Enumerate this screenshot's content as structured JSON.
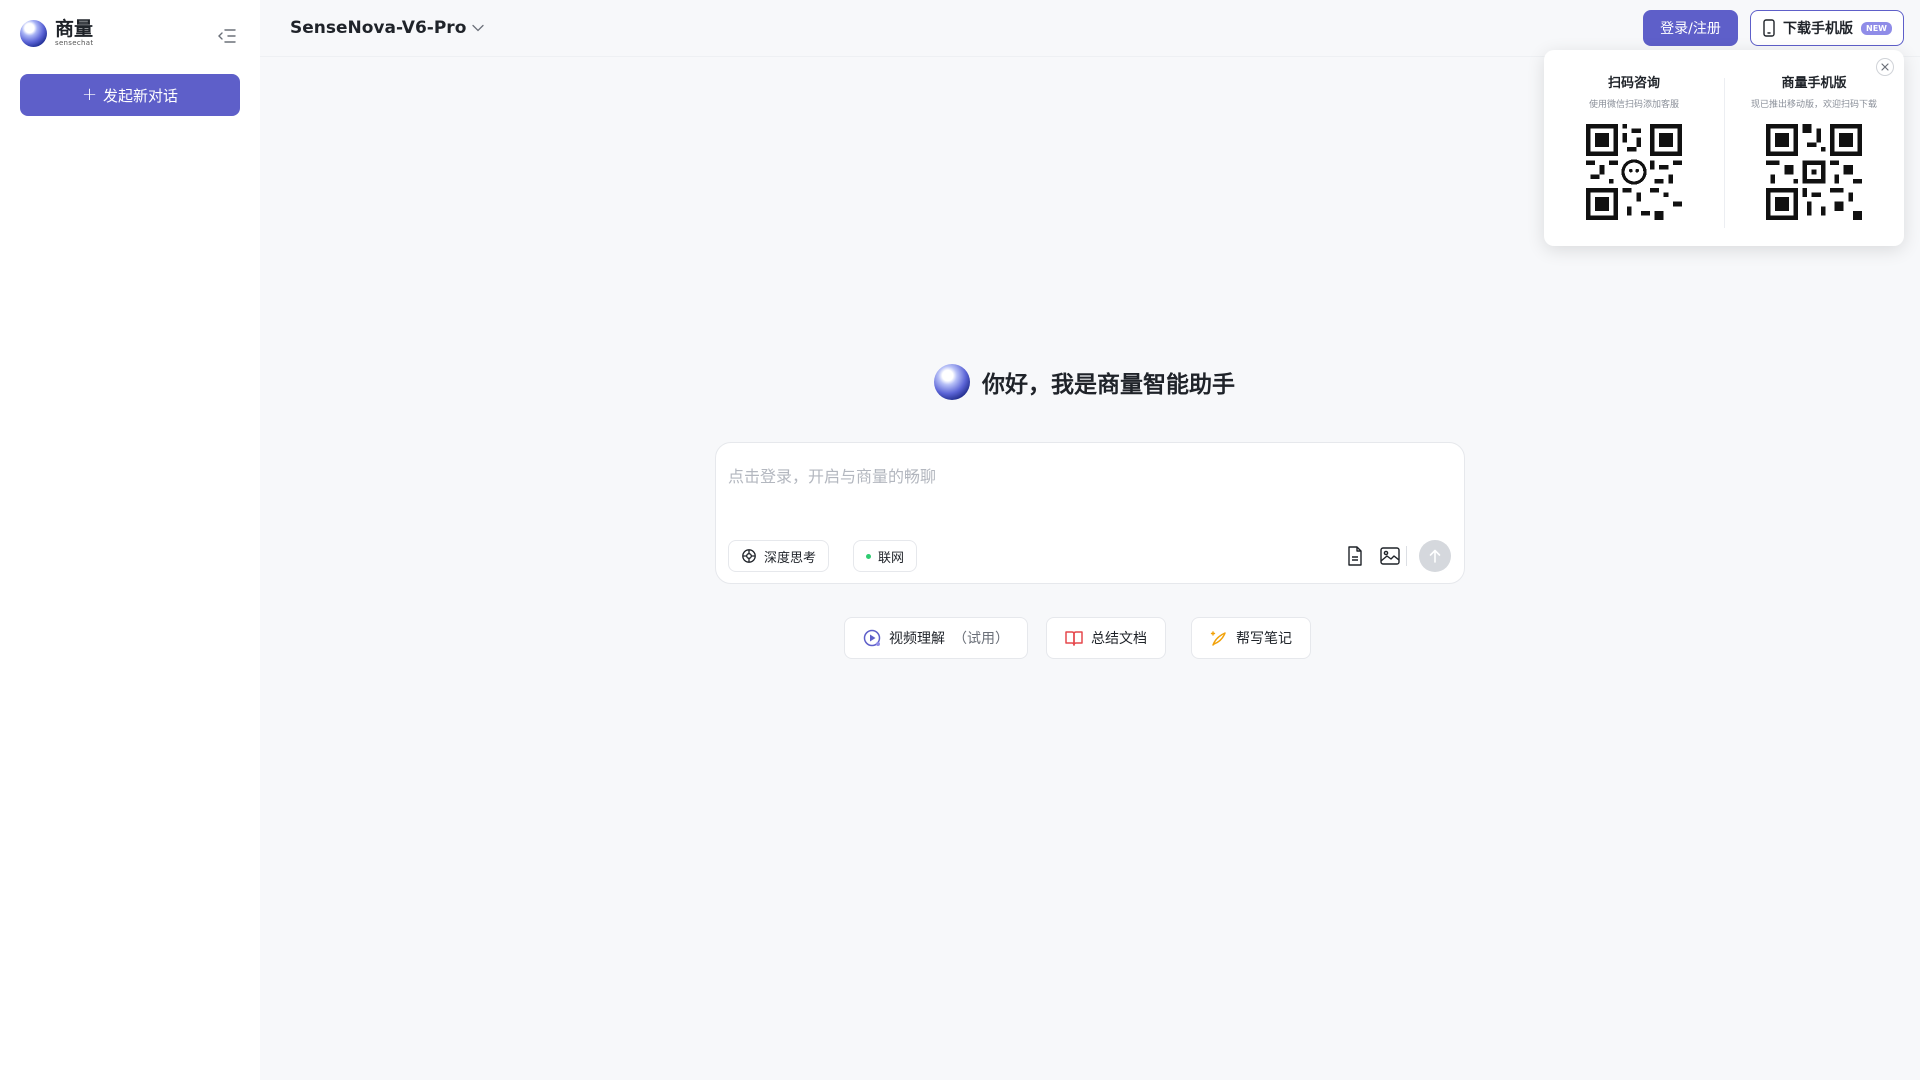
{
  "sidebar": {
    "logo_title": "商量",
    "logo_subtitle": "sensechat",
    "new_chat_label": "发起新对话"
  },
  "header": {
    "model_name": "SenseNova-V6-Pro",
    "login_label": "登录/注册",
    "download_label": "下载手机版",
    "new_badge": "NEW"
  },
  "qr_popover": {
    "left_title": "扫码咨询",
    "left_desc": "使用微信扫码添加客服",
    "right_title": "商量手机版",
    "right_desc": "现已推出移动版，欢迎扫码下载"
  },
  "main": {
    "greeting": "你好，我是商量智能助手",
    "input_placeholder": "点击登录，开启与商量的畅聊",
    "deep_think_label": "深度思考",
    "web_label": "联网",
    "suggestions": [
      {
        "label": "视频理解",
        "suffix": "（试用）",
        "icon": "video-play-icon"
      },
      {
        "label": "总结文档",
        "icon": "book-icon"
      },
      {
        "label": "帮写笔记",
        "icon": "pen-sparkle-icon"
      }
    ]
  },
  "colors": {
    "accent": "#5e5fc9",
    "background": "#f7f8fa",
    "online_dot": "#2ecc71"
  }
}
